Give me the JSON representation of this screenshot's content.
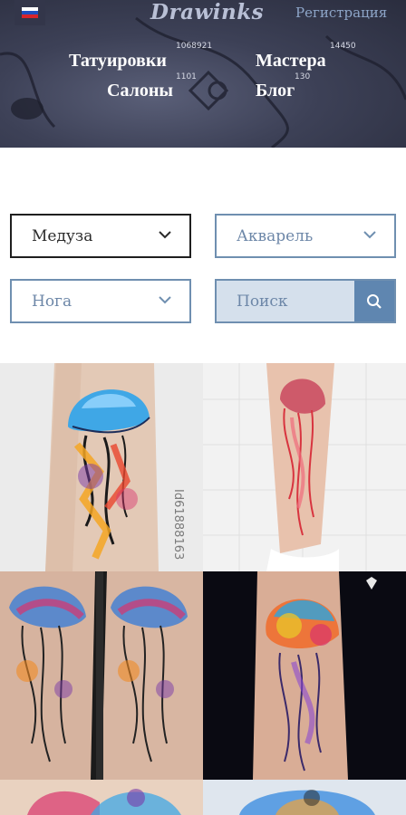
{
  "header": {
    "logo": "Drawinks",
    "register_label": "Регистрация",
    "language": "ru",
    "flag_colors": [
      "#ffffff",
      "#1f4fbf",
      "#d8242a"
    ],
    "nav": [
      {
        "label": "Татуировки",
        "count": "1068921"
      },
      {
        "label": "Мастера",
        "count": "14450"
      },
      {
        "label": "Салоны",
        "count": "1101"
      },
      {
        "label": "Блог",
        "count": "130"
      }
    ]
  },
  "filters": {
    "subject": {
      "value": "Медуза"
    },
    "style": {
      "value": "Акварель"
    },
    "body_part": {
      "value": "Нога"
    },
    "search": {
      "placeholder": "Поиск",
      "value": ""
    }
  },
  "gallery": {
    "watermark": "Id61888163",
    "images": [
      {
        "subject": "jellyfish-watercolor-tattoo-calf"
      },
      {
        "subject": "red-jellyfish-tattoo-leg"
      },
      {
        "subject": "jellyfish-watercolor-tattoo-thigh-before-after"
      },
      {
        "subject": "jellyfish-watercolor-tattoo-forearm"
      },
      {
        "subject": "jellyfish-tattoo-partial"
      },
      {
        "subject": "jellyfish-tattoo-partial"
      }
    ]
  },
  "colors": {
    "accent": "#5f86b0",
    "border": "#6f8fb0",
    "header_bg": "#3d4157"
  }
}
